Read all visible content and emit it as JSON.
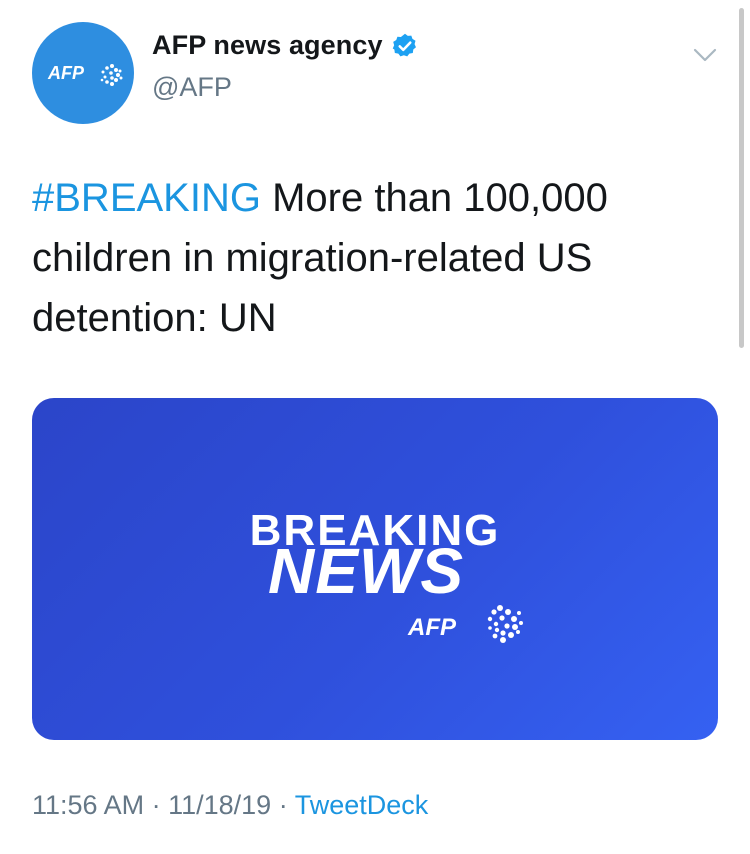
{
  "author": {
    "display_name": "AFP news agency",
    "handle": "@AFP",
    "avatar_logo_text": "AFP",
    "verified_icon": "verified-badge-icon"
  },
  "menu": {
    "icon": "chevron-down-icon"
  },
  "tweet": {
    "hashtag": "#BREAKING",
    "text": " More than 100,000 children in migration-related US detention: UN"
  },
  "media": {
    "line1": "BREAKING",
    "line2": "NEWS",
    "logo_text": "AFP"
  },
  "meta": {
    "time": "11:56 AM",
    "separator1": " · ",
    "date": "11/18/19",
    "separator2": " · ",
    "source": "TweetDeck"
  },
  "colors": {
    "accent": "#1b95e0",
    "avatar_bg": "#2e8ee0",
    "media_bg": "#2f50dc",
    "text_primary": "#14171a",
    "text_secondary": "#657786"
  }
}
